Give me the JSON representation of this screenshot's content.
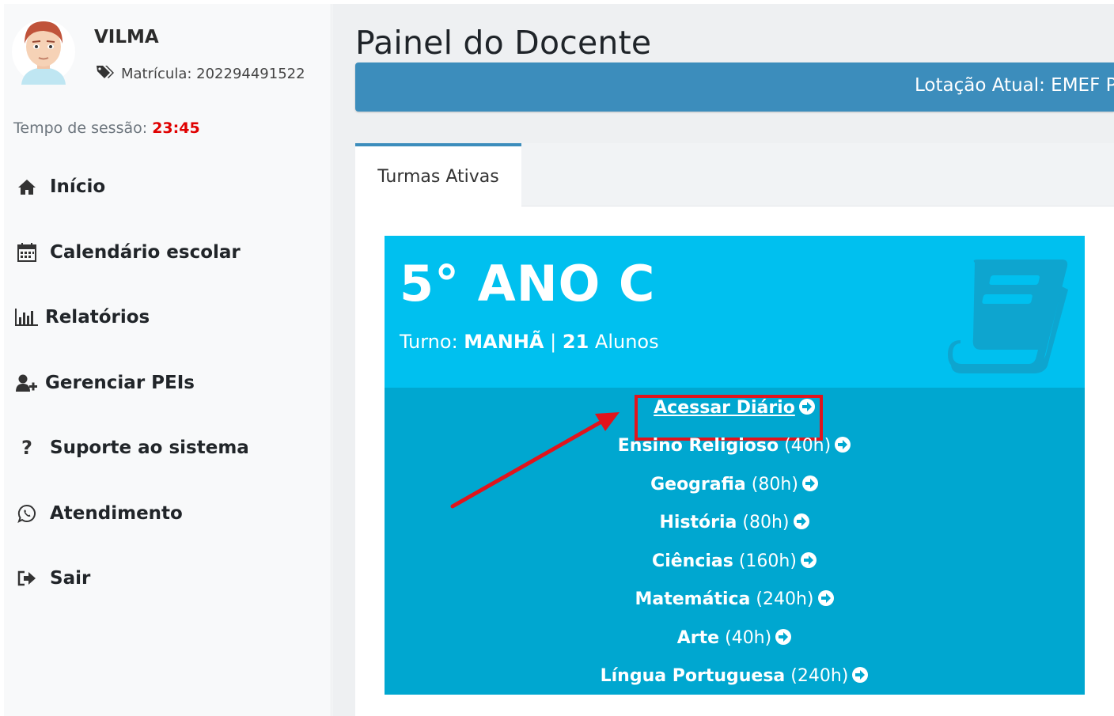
{
  "user": {
    "name": "VILMA",
    "matricula": "Matrícula: 202294491522"
  },
  "session": {
    "label": "Tempo de sessão:",
    "time": "23:45"
  },
  "nav": [
    {
      "label": "Início",
      "icon": "home-icon"
    },
    {
      "label": "Calendário escolar",
      "icon": "calendar-icon"
    },
    {
      "label": "Relatórios",
      "icon": "bar-chart-icon"
    },
    {
      "label": "Gerenciar PEIs",
      "icon": "user-plus-icon"
    },
    {
      "label": "Suporte ao sistema",
      "icon": "question-icon"
    },
    {
      "label": "Atendimento",
      "icon": "whatsapp-icon"
    },
    {
      "label": "Sair",
      "icon": "sign-out-icon"
    }
  ],
  "page": {
    "title": "Painel do Docente",
    "lotacao": "Lotação Atual: EMEF PR"
  },
  "tabs": [
    {
      "label": "Turmas Ativas",
      "active": true
    }
  ],
  "card": {
    "title": "5° ANO C",
    "turno_label": "Turno:",
    "turno_value": "MANHÃ",
    "separator": "|",
    "alunos_count": "21",
    "alunos_label": "Alunos",
    "acessar_label": "Acessar Diário",
    "subjects": [
      {
        "name": "Ensino Religioso",
        "hours": "(40h)"
      },
      {
        "name": "Geografia",
        "hours": "(80h)"
      },
      {
        "name": "História",
        "hours": "(80h)"
      },
      {
        "name": "Ciências",
        "hours": "(160h)"
      },
      {
        "name": "Matemática",
        "hours": "(240h)"
      },
      {
        "name": "Arte",
        "hours": "(40h)"
      },
      {
        "name": "Língua Portuguesa",
        "hours": "(240h)"
      }
    ]
  },
  "colors": {
    "card_top": "#00c0ef",
    "card_bottom": "#00a7d0",
    "lotacao_bar": "#3c8dbc",
    "session_time": "#e00000",
    "annotation": "#e0141c"
  }
}
